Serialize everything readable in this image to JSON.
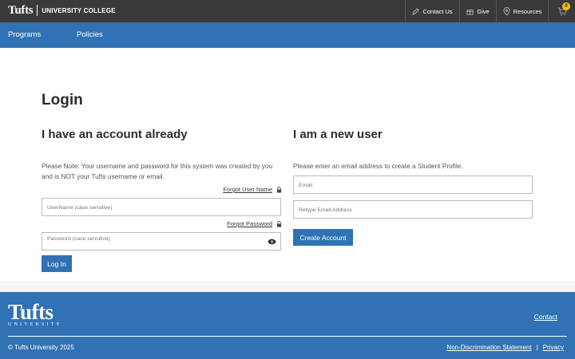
{
  "header": {
    "brand_name": "Tufts",
    "brand_unit": "UNIVERSITY COLLEGE",
    "utility_links": [
      {
        "label": "Contact Us",
        "icon": "pencil-icon"
      },
      {
        "label": "Give",
        "icon": "gift-icon"
      },
      {
        "label": "Resources",
        "icon": "map-pin-icon"
      }
    ],
    "cart_count": "0"
  },
  "nav": {
    "items": [
      "Programs",
      "Policies"
    ]
  },
  "main": {
    "page_title": "Login",
    "existing": {
      "heading": "I have an account already",
      "note": "Please Note: Your username and password for this system was created by you and is NOT your Tufts username or email.",
      "forgot_username": "Forgot User Name",
      "username_placeholder": "UserName (case sensitive)",
      "forgot_password": "Forgot Password",
      "password_placeholder": "Password (case sensitive)",
      "login_button": "Log In"
    },
    "new_user": {
      "heading": "I am a new user",
      "instructions": "Please enter an email address to create a Student Profile.",
      "email_placeholder": "Email",
      "retype_placeholder": "Retype Email Address",
      "create_button": "Create Account"
    }
  },
  "footer": {
    "logo_word": "Tufts",
    "logo_sub": "UNIVERSITY",
    "contact_link": "Contact",
    "copyright": "© Tufts University 2025",
    "links": [
      "Non-Discrimination Statement",
      "Privacy"
    ],
    "separator": "|"
  },
  "colors": {
    "primary_blue": "#3172b5",
    "top_bar": "#3a3a3a",
    "cart_badge": "#f0c20a"
  }
}
